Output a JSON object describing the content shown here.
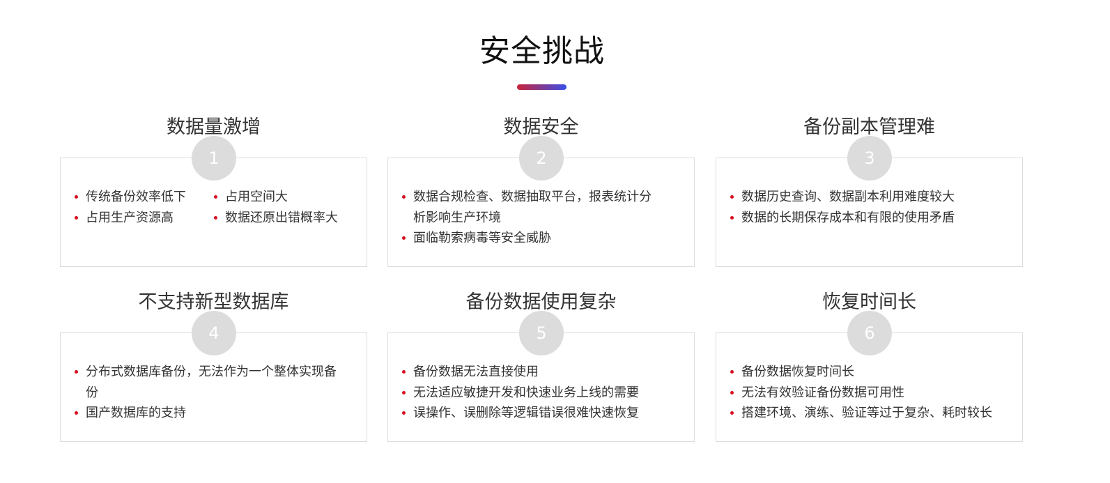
{
  "header": {
    "title": "安全挑战",
    "underline_gradient": [
      "#c8243a",
      "#3a4fe8"
    ]
  },
  "accent_color": "#d7101f",
  "cards": [
    {
      "number": "1",
      "heading": "数据量激增",
      "items": [
        "传统备份效率低下",
        "占用空间大",
        "占用生产资源高",
        "数据还原出错概率大"
      ]
    },
    {
      "number": "2",
      "heading": "数据安全",
      "items": [
        "数据合规检查、数据抽取平台，报表统计分析影响生产环境",
        "面临勒索病毒等安全威胁"
      ]
    },
    {
      "number": "3",
      "heading": "备份副本管理难",
      "items": [
        "数据历史查询、数据副本利用难度较大",
        "数据的长期保存成本和有限的使用矛盾"
      ]
    },
    {
      "number": "4",
      "heading": "不支持新型数据库",
      "items": [
        "分布式数据库备份，无法作为一个整体实现备份",
        "国产数据库的支持"
      ]
    },
    {
      "number": "5",
      "heading": "备份数据使用复杂",
      "items": [
        "备份数据无法直接使用",
        "无法适应敏捷开发和快速业务上线的需要",
        "误操作、误删除等逻辑错误很难快速恢复"
      ]
    },
    {
      "number": "6",
      "heading": "恢复时间长",
      "items": [
        "备份数据恢复时间长",
        "无法有效验证备份数据可用性",
        "搭建环境、演练、验证等过于复杂、耗时较长"
      ]
    }
  ]
}
